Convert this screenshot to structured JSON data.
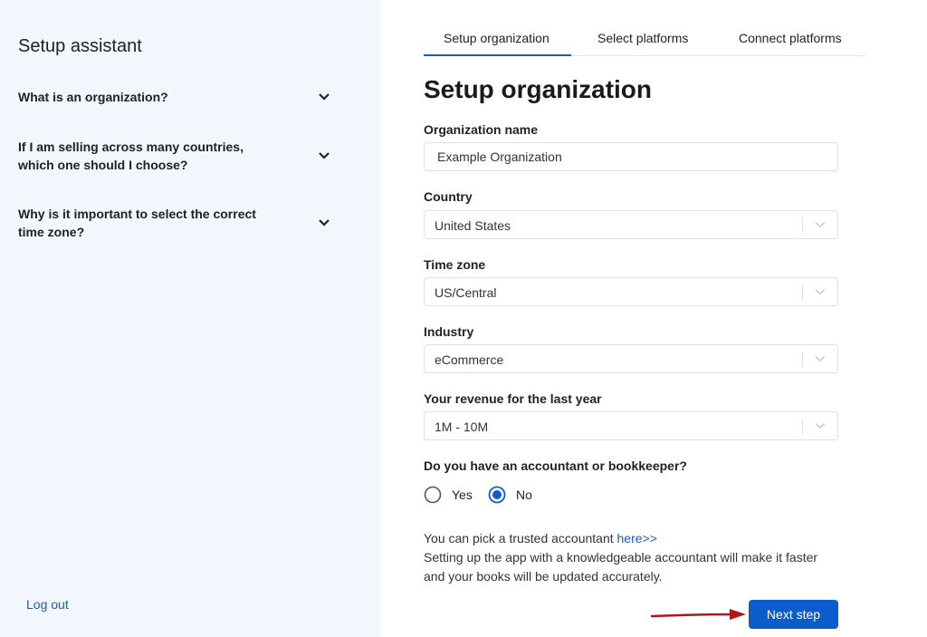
{
  "sidebar": {
    "title": "Setup assistant",
    "faq": [
      {
        "question": "What is an organization?"
      },
      {
        "question": "If I am selling across many countries, which one should I choose?"
      },
      {
        "question": "Why is it important to select the correct time zone?"
      }
    ],
    "logout_label": "Log out"
  },
  "tabs": [
    {
      "label": "Setup organization",
      "active": true
    },
    {
      "label": "Select platforms",
      "active": false
    },
    {
      "label": "Connect platforms",
      "active": false
    }
  ],
  "form": {
    "title": "Setup organization",
    "org_name": {
      "label": "Organization name",
      "value": "Example Organization"
    },
    "country": {
      "label": "Country",
      "value": "United States"
    },
    "timezone": {
      "label": "Time zone",
      "value": "US/Central"
    },
    "industry": {
      "label": "Industry",
      "value": "eCommerce"
    },
    "revenue": {
      "label": "Your revenue for the last year",
      "value": "1M - 10M"
    },
    "accountant": {
      "question": "Do you have an accountant or bookkeeper?",
      "options": [
        {
          "label": "Yes",
          "selected": false
        },
        {
          "label": "No",
          "selected": true
        }
      ]
    },
    "info": {
      "line1_prefix": "You can pick a trusted accountant ",
      "link_label": "here>>",
      "line2": "Setting up the app with a knowledgeable accountant will make it faster and your books will be updated accurately."
    },
    "next_label": "Next step"
  },
  "colors": {
    "sidebar_bg": "#f2f6fd",
    "accent": "#1a5fb4",
    "button": "#0d5ccb",
    "annotation_arrow": "#b3151b"
  }
}
